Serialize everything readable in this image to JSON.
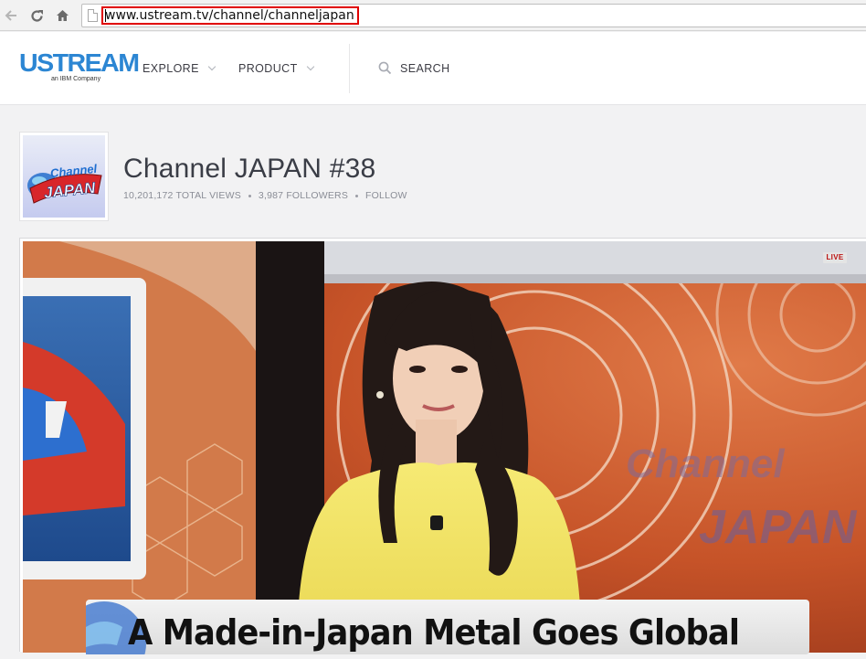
{
  "browser": {
    "url": "www.ustream.tv/channel/channeljapan",
    "icons": [
      "back-icon",
      "reload-icon",
      "home-icon",
      "page-icon"
    ]
  },
  "header": {
    "logo": "USTREAM",
    "logo_sub": "an IBM Company",
    "nav": [
      {
        "label": "EXPLORE"
      },
      {
        "label": "PRODUCT"
      }
    ],
    "search_label": "SEARCH"
  },
  "channel": {
    "title": "Channel JAPAN #38",
    "views": "10,201,172 TOTAL VIEWS",
    "followers": "3,987 FOLLOWERS",
    "follow_label": "FOLLOW",
    "thumb_text_top": "Channel",
    "thumb_text_bottom": "JAPAN"
  },
  "video": {
    "live_label": "LIVE",
    "caption": "A Made-in-Japan Metal Goes Global",
    "background_text_top": "Channel",
    "background_text_bottom": "JAPAN"
  },
  "colors": {
    "brand": "#2c86d3",
    "url_highlight": "#e00000",
    "studio_orange": "#c85a2c",
    "presenter_yellow": "#f2e56a"
  }
}
